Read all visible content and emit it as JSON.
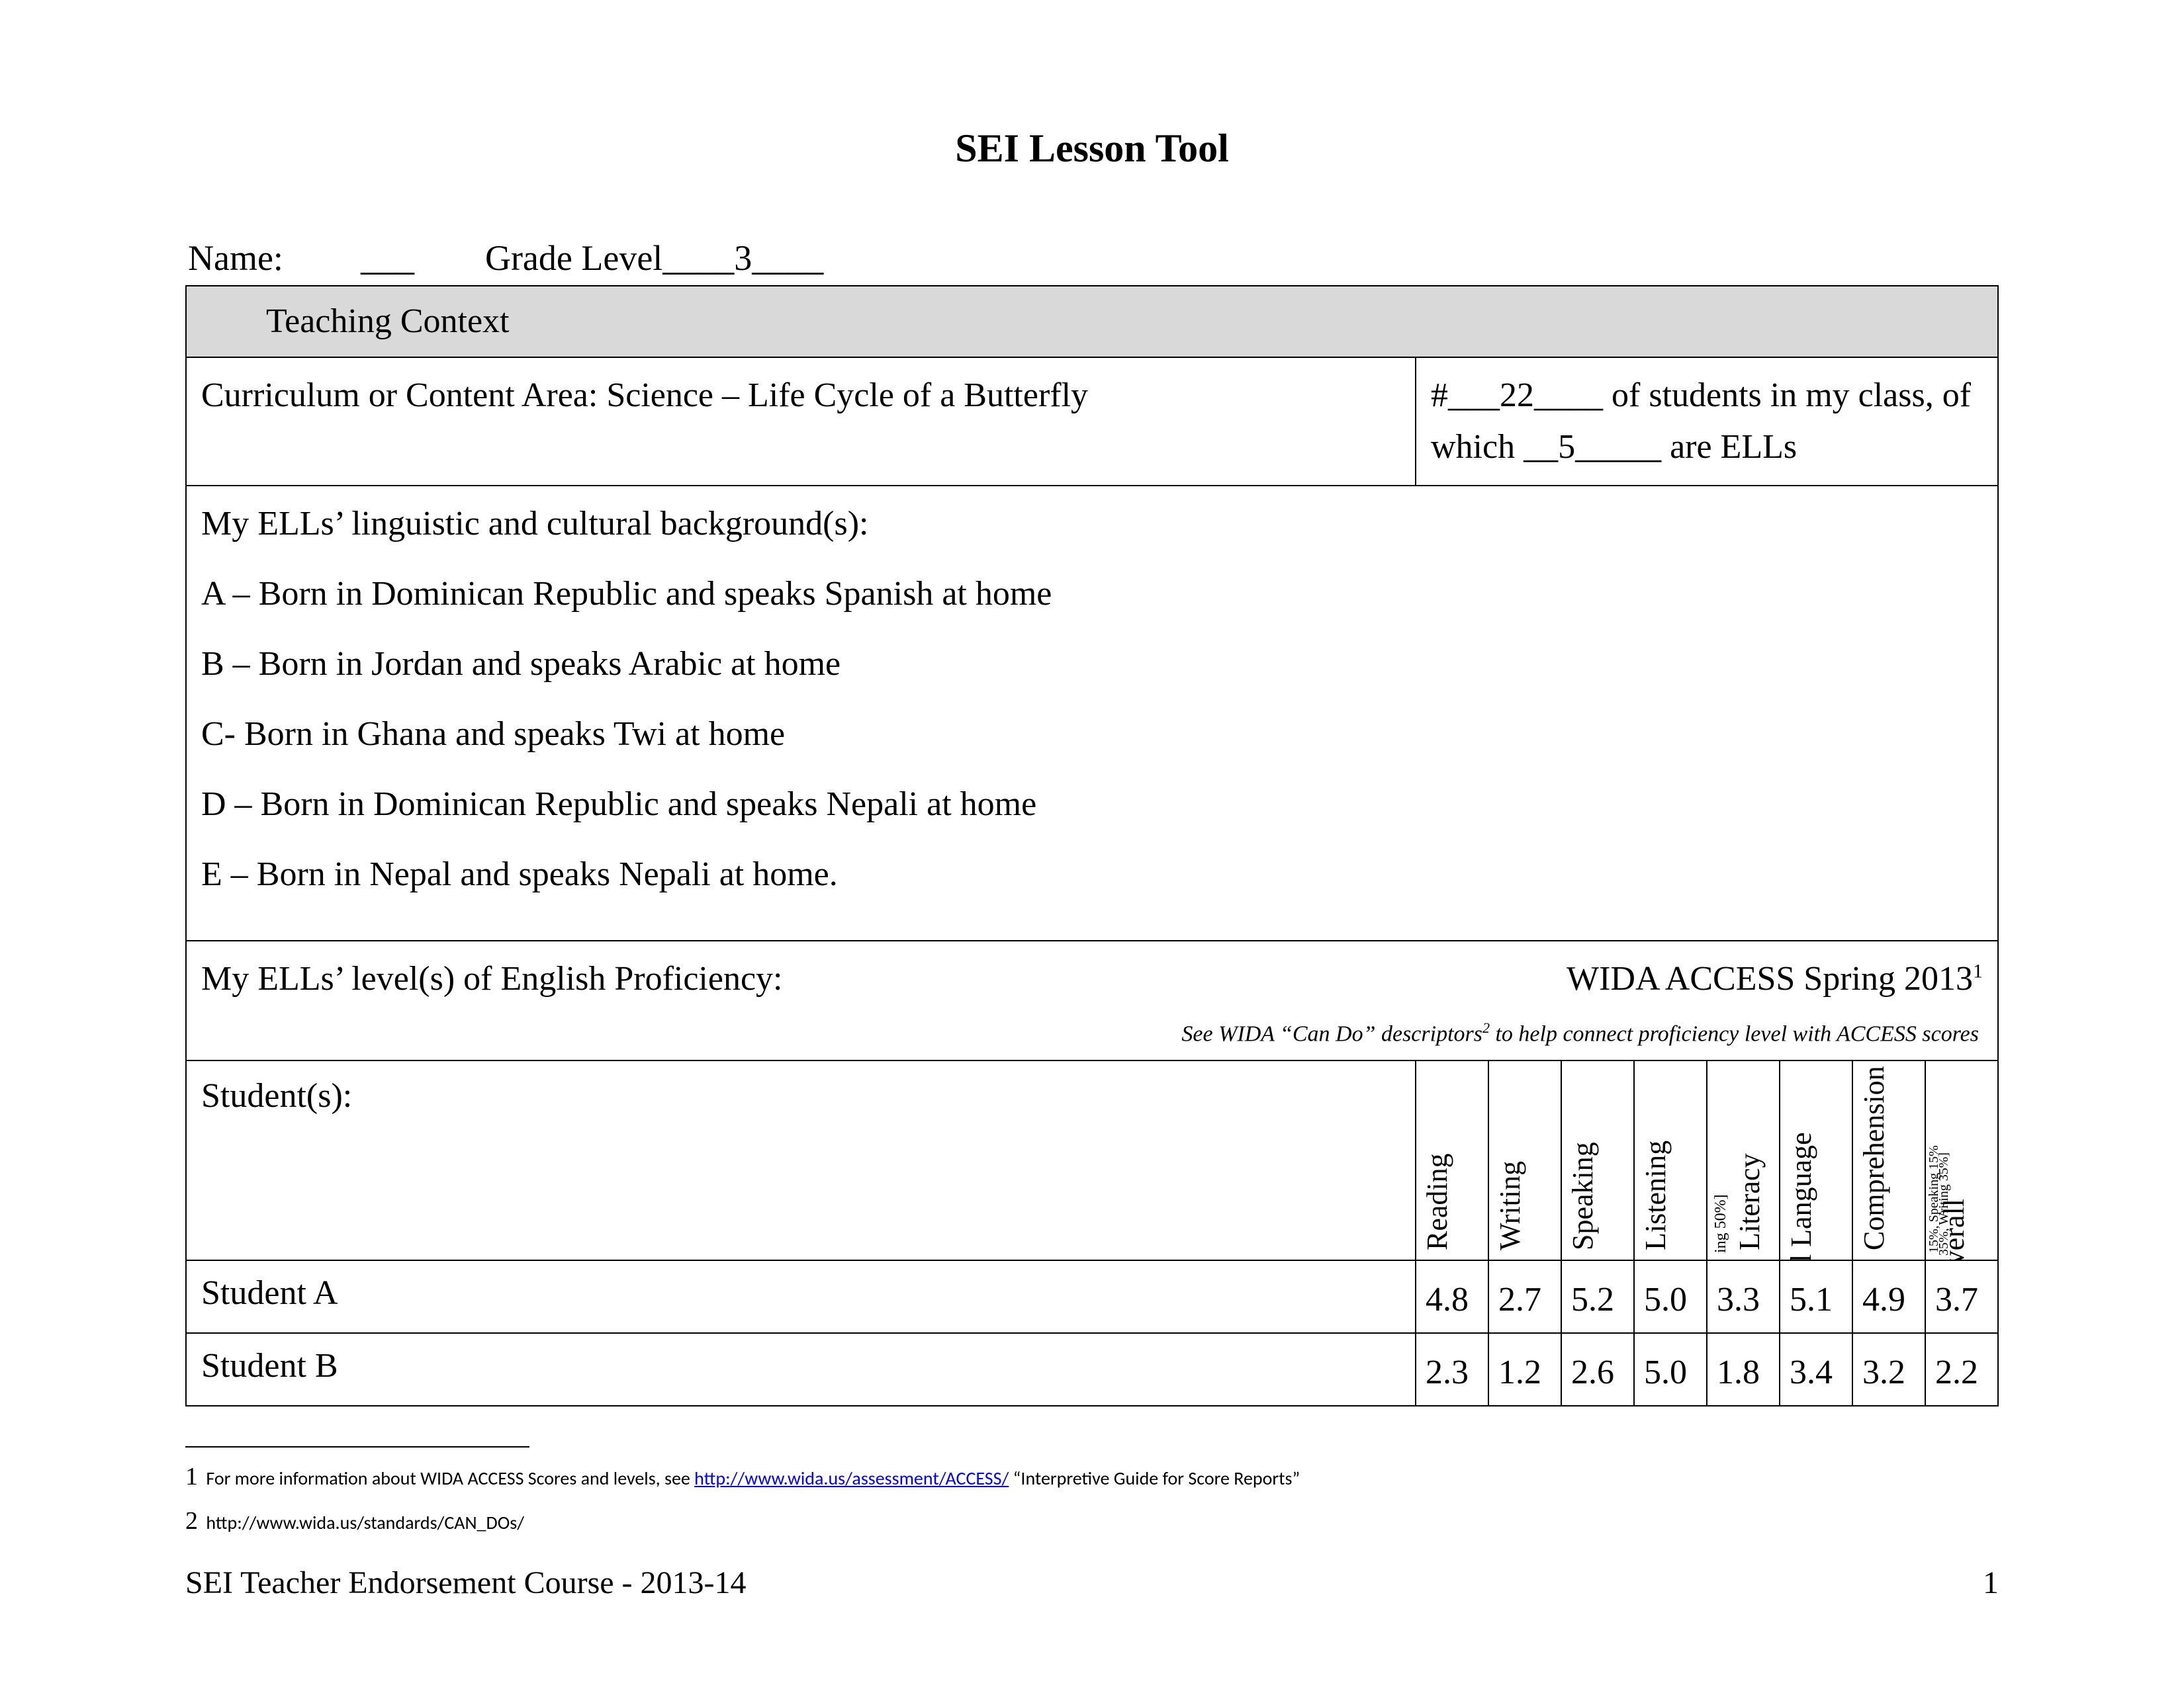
{
  "title": "SEI Lesson Tool",
  "name_label": "Name:",
  "name_value": "___",
  "grade_label": "Grade Level",
  "grade_value_prefix": "____",
  "grade_value": "3",
  "grade_value_suffix": "____",
  "teaching_context_header": "Teaching Context",
  "curriculum_label": "Curriculum or Content Area: Science – Life Cycle of a Butterfly",
  "class_counts": "#___22____ of students in my class, of which __5_____ are ELLs",
  "backgrounds_heading": "My ELLs’ linguistic and cultural background(s):",
  "backgrounds": {
    "a": "A – Born in Dominican Republic and speaks Spanish at home",
    "b": "B – Born in Jordan and speaks Arabic at home",
    "c": "C- Born in Ghana and speaks Twi at home",
    "d": "D – Born in Dominican Republic and speaks Nepali at home",
    "e": "E – Born in Nepal and speaks Nepali at home."
  },
  "proficiency_label": "My ELLs’ level(s) of English Proficiency:",
  "wida_label": "WIDA ACCESS Spring 2013",
  "wida_sup": "1",
  "helper_pre": "See WIDA “Can Do” descriptors",
  "helper_sup": "2",
  "helper_post": " to help connect proficiency level with ACCESS scores",
  "students_label": "Student(s):",
  "columns": {
    "reading": "Reading",
    "writing": "Writing",
    "speaking": "Speaking",
    "listening": "Listening",
    "literacy": "Literacy",
    "literacy_sub": "ing 50%]",
    "oral": "Oral Language",
    "comprehension": "Comprehension",
    "overall": "Overall",
    "overall_sub1": "15%, Speaking 15%",
    "overall_sub2": "35%, Writing 35%]"
  },
  "students": {
    "a": {
      "name": "Student A",
      "reading": "4.8",
      "writing": "2.7",
      "speaking": "5.2",
      "listening": "5.0",
      "literacy": "3.3",
      "oral": "5.1",
      "comprehension": "4.9",
      "overall": "3.7"
    },
    "b": {
      "name": "Student B",
      "reading": "2.3",
      "writing": "1.2",
      "speaking": "2.6",
      "listening": "5.0",
      "literacy": "1.8",
      "oral": "3.4",
      "comprehension": "3.2",
      "overall": "2.2"
    }
  },
  "footnotes": {
    "f1_num": "1",
    "f1_pre": " For more information about WIDA ACCESS Scores and levels, see  ",
    "f1_link": "http://www.wida.us/assessment/ACCESS/",
    "f1_post": " “Interpretive Guide for Score Reports”",
    "f2_num": "2",
    "f2_text": " http://www.wida.us/standards/CAN_DOs/"
  },
  "footer_left": "SEI Teacher Endorsement Course  -  2013-14",
  "footer_right": "1"
}
